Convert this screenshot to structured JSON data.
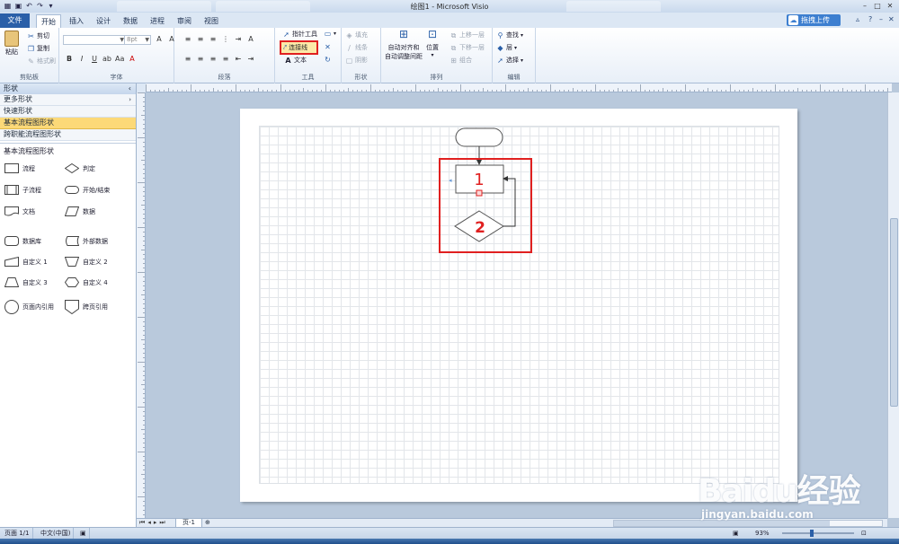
{
  "window": {
    "title": "绘图1 - Microsoft Visio"
  },
  "tabs": {
    "file": "文件",
    "items": [
      "开始",
      "插入",
      "设计",
      "数据",
      "进程",
      "审阅",
      "视图"
    ],
    "active_index": 0
  },
  "upload_button": "拖拽上传",
  "ribbon": {
    "clipboard": {
      "label": "剪贴板",
      "paste": "粘贴",
      "cut": "剪切",
      "copy": "复制",
      "format_painter": "格式刷"
    },
    "font": {
      "label": "字体",
      "size_value": "8pt"
    },
    "paragraph": {
      "label": "段落"
    },
    "tools": {
      "label": "工具",
      "pointer": "指针工具",
      "connector": "连接线",
      "text": "文本"
    },
    "shape": {
      "label": "形状",
      "fill": "填充",
      "line": "线条",
      "shadow": "阴影"
    },
    "arrange": {
      "label": "排列",
      "auto_align_line1": "自动对齐和",
      "auto_align_line2": "自动调整间距",
      "position": "位置",
      "bring_forward": "上移一层",
      "send_backward": "下移一层",
      "group": "组合"
    },
    "editing": {
      "label": "编辑",
      "find": "查找",
      "layer": "层",
      "select": "选择"
    }
  },
  "shapes_panel": {
    "header": "形状",
    "rows": [
      "更多形状",
      "快速形状",
      "基本流程图形状",
      "跨职能流程图形状"
    ],
    "active_row_index": 2,
    "stencil_title": "基本流程图形状",
    "items": [
      "流程",
      "判定",
      "子流程",
      "开始/结束",
      "文档",
      "数据",
      "数据库",
      "外部数据",
      "自定义 1",
      "自定义 2",
      "自定义 3",
      "自定义 4",
      "页面内引用",
      "跨页引用"
    ]
  },
  "diagram": {
    "process_label": "1",
    "decision_label": "2"
  },
  "page_tab": "页-1",
  "status": {
    "page": "页面 1/1",
    "language": "中文(中国)",
    "zoom": "93%"
  },
  "watermark": {
    "logo": "Baidu经验",
    "url": "jingyan.baidu.com"
  },
  "colors": {
    "file_tab": "#2a5fa8",
    "highlight_box": "#e02020",
    "active_stencil": "#fcd978"
  }
}
